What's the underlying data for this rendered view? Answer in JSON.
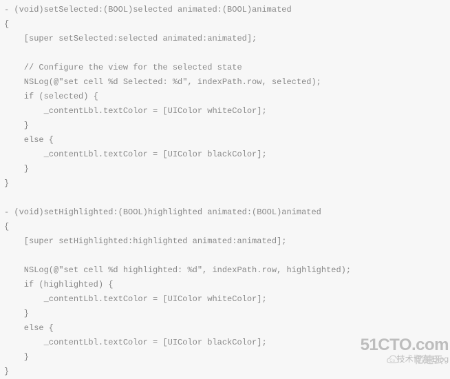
{
  "code": {
    "lines": [
      "- (void)setSelected:(BOOL)selected animated:(BOOL)animated",
      "{",
      "    [super setSelected:selected animated:animated];",
      "",
      "    // Configure the view for the selected state",
      "    NSLog(@\"set cell %d Selected: %d\", indexPath.row, selected);",
      "    if (selected) {",
      "        _contentLbl.textColor = [UIColor whiteColor];",
      "    }",
      "    else {",
      "        _contentLbl.textColor = [UIColor blackColor];",
      "    }",
      "}",
      "",
      "- (void)setHighlighted:(BOOL)highlighted animated:(BOOL)animated",
      "{",
      "    [super setHighlighted:highlighted animated:animated];",
      "",
      "    NSLog(@\"set cell %d highlighted: %d\", indexPath.row, highlighted);",
      "    if (highlighted) {",
      "        _contentLbl.textColor = [UIColor whiteColor];",
      "    }",
      "    else {",
      "        _contentLbl.textColor = [UIColor blackColor];",
      "    }",
      "}"
    ]
  },
  "watermark": {
    "brand": "51CTO.com",
    "sub": "技术博客  Blog",
    "yisu": "亿速云"
  }
}
